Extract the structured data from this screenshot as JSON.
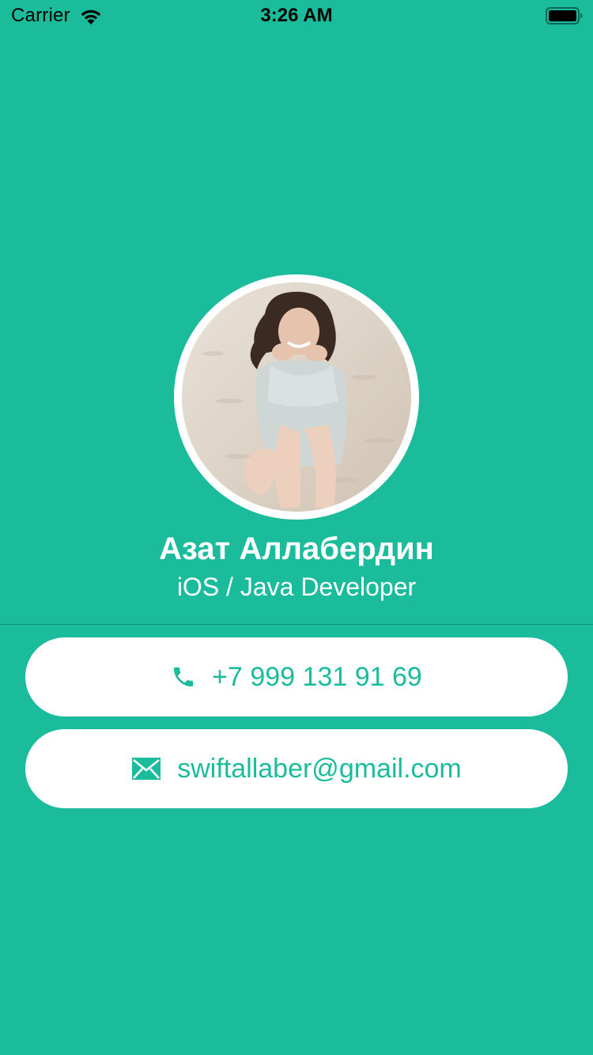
{
  "status_bar": {
    "carrier": "Carrier",
    "time": "3:26 AM",
    "wifi_icon": "wifi-icon",
    "battery_icon": "battery-icon"
  },
  "profile": {
    "name": "Азат Аллабердин",
    "role": "iOS / Java Developer",
    "avatar": "avatar-photo"
  },
  "contacts": {
    "phone": {
      "icon": "phone-icon",
      "label": "+7 999 131 91 69"
    },
    "email": {
      "icon": "envelope-icon",
      "label": "swiftallaber@gmail.com"
    }
  },
  "colors": {
    "background": "#1ABC9C",
    "button_background": "#FFFFFF",
    "accent": "#1ABC9C",
    "text_on_background": "#FFFFFF"
  }
}
